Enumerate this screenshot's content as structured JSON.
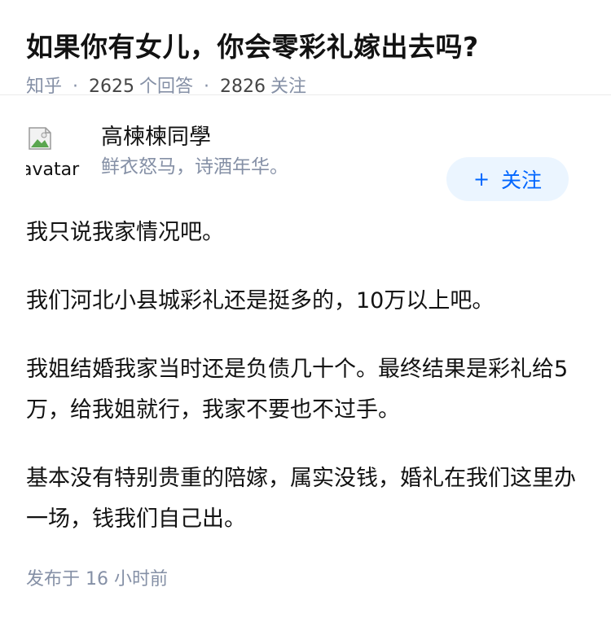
{
  "question": {
    "title": "如果你有女儿，你会零彩礼嫁出去吗?",
    "source": "知乎",
    "separator": "·",
    "answer_count": "2625",
    "answer_label": "个回答",
    "follower_count": "2826",
    "follower_label": "关注"
  },
  "author": {
    "avatar_alt": "avatar",
    "name": "高楝楝同學",
    "bio": "鲜衣怒马，诗酒年华。",
    "follow_icon": "+",
    "follow_label": "关注"
  },
  "answer": {
    "paragraphs": [
      "我只说我家情况吧。",
      "我们河北小县城彩礼还是挺多的，10万以上吧。",
      "我姐结婚我家当时还是负债几十个。最终结果是彩礼给5万，给我姐就行，我家不要也不过手。",
      "基本没有特别贵重的陪嫁，属实没钱，婚礼在我们这里办一场，钱我们自己出。"
    ],
    "published": "发布于  16 小时前"
  },
  "colors": {
    "meta_gray": "#8590a6",
    "follow_bg": "#ebf5ff",
    "follow_text": "#0066ff"
  }
}
